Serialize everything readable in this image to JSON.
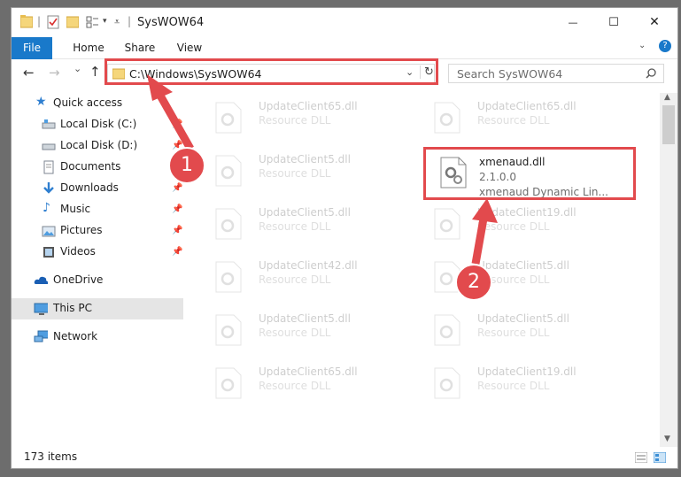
{
  "window": {
    "title": "SysWOW64",
    "controls": {
      "minimize": "—",
      "maximize": "☐",
      "close": "✕"
    }
  },
  "ribbon": {
    "tabs": [
      "File",
      "Home",
      "Share",
      "View"
    ],
    "help": "?"
  },
  "nav": {
    "back": "←",
    "forward": "→",
    "recent": "⌄",
    "up": "↑",
    "address": "C:\\Windows\\SysWOW64",
    "refresh": "↻",
    "search_placeholder": "Search SysWOW64"
  },
  "sidebar": {
    "items": [
      {
        "label": "Quick access",
        "icon": "star-icon"
      },
      {
        "label": "Local Disk (C:)",
        "icon": "drive-icon"
      },
      {
        "label": "Local Disk (D:)",
        "icon": "drive-icon"
      },
      {
        "label": "Documents",
        "icon": "documents-icon"
      },
      {
        "label": "Downloads",
        "icon": "download-icon"
      },
      {
        "label": "Music",
        "icon": "music-icon"
      },
      {
        "label": "Pictures",
        "icon": "pictures-icon"
      },
      {
        "label": "Videos",
        "icon": "videos-icon"
      },
      {
        "label": "OneDrive",
        "icon": "cloud-icon"
      },
      {
        "label": "This PC",
        "icon": "computer-icon"
      },
      {
        "label": "Network",
        "icon": "network-icon"
      }
    ]
  },
  "files": [
    {
      "name": "UpdateClient65.dll",
      "type": "Resource DLL"
    },
    {
      "name": "UpdateClient65.dll",
      "type": "Resource DLL"
    },
    {
      "name": "UpdateClient5.dll",
      "type": "Resource DLL"
    },
    {
      "name": "xmenaud.dll",
      "version": "2.1.0.0",
      "desc": "xmenaud Dynamic Lin..."
    },
    {
      "name": "UpdateClient5.dll",
      "type": "Resource DLL"
    },
    {
      "name": "UpdateClient19.dll",
      "type": "Resource DLL"
    },
    {
      "name": "UpdateClient42.dll",
      "type": "Resource DLL"
    },
    {
      "name": "UpdateClient5.dll",
      "type": "Resource DLL"
    },
    {
      "name": "UpdateClient5.dll",
      "type": "Resource DLL"
    },
    {
      "name": "UpdateClient5.dll",
      "type": "Resource DLL"
    },
    {
      "name": "UpdateClient65.dll",
      "type": "Resource DLL"
    },
    {
      "name": "UpdateClient19.dll",
      "type": "Resource DLL"
    }
  ],
  "status": {
    "count": "173 items"
  },
  "annotations": {
    "marker1": "1",
    "marker2": "2",
    "color": "#e24a4d"
  }
}
